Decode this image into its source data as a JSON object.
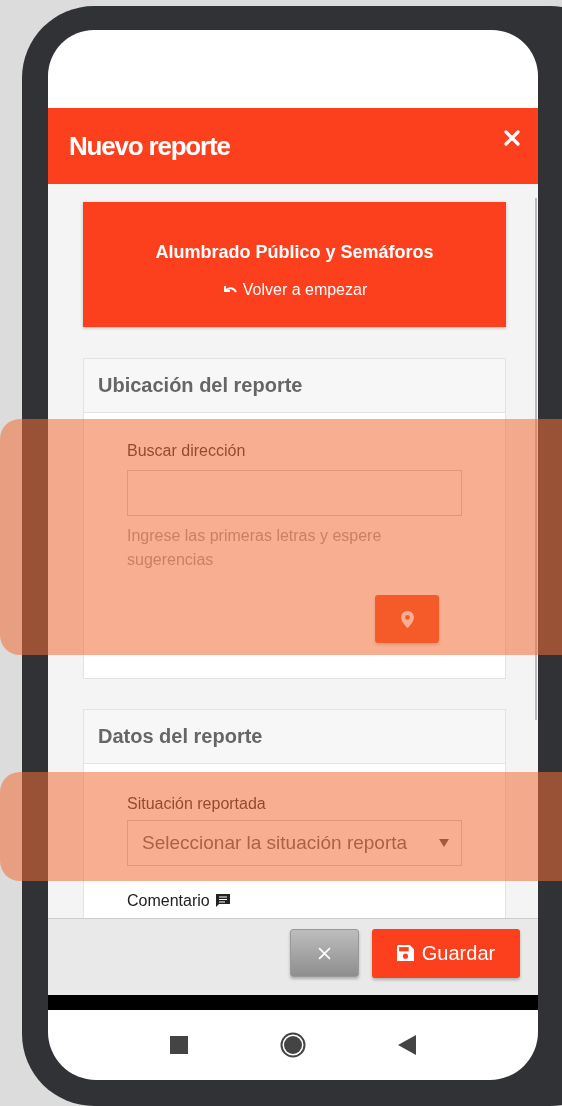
{
  "header": {
    "title": "Nuevo reporte"
  },
  "category": {
    "title": "Alumbrado Público y Semáforos",
    "restart_link": "Volver a empezar"
  },
  "sections": [
    {
      "title": "Ubicación del reporte",
      "fields": [
        {
          "kind": "address",
          "label": "Buscar dirección",
          "help": "Ingrese las primeras letras y espere sugerencias",
          "highlighted": true
        }
      ]
    },
    {
      "title": "Datos del reporte",
      "fields": [
        {
          "kind": "select",
          "label": "Situación reportada",
          "value": "Seleccionar la situación reporta",
          "highlighted": true
        },
        {
          "kind": "comment",
          "label": "Comentario",
          "highlighted": false
        }
      ]
    }
  ],
  "footer": {
    "save_button": "Guardar"
  }
}
